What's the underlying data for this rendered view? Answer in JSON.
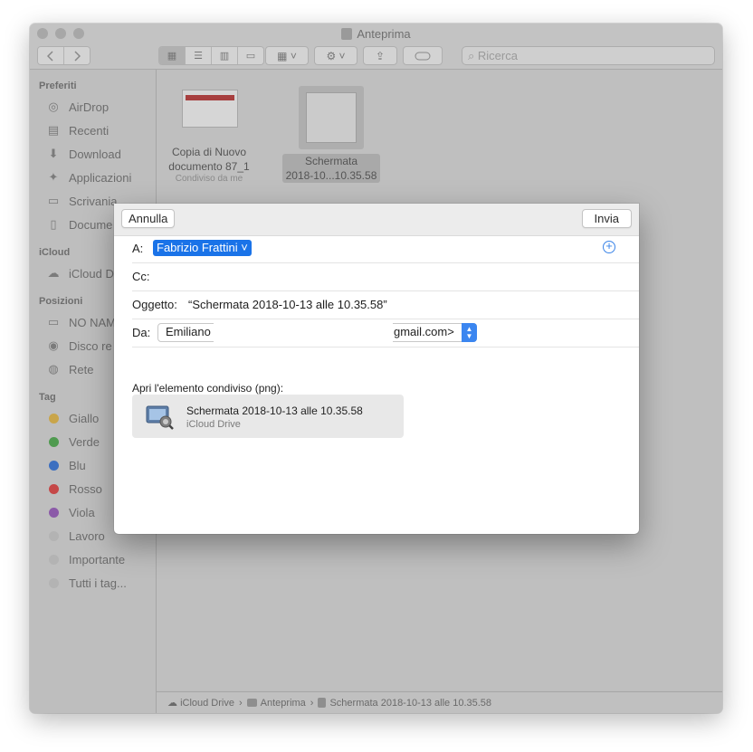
{
  "window": {
    "title": "Anteprima"
  },
  "toolbar": {
    "search_placeholder": "Ricerca"
  },
  "sidebar": {
    "sections": {
      "favorites": "Preferiti",
      "icloud": "iCloud",
      "locations": "Posizioni",
      "tags": "Tag"
    },
    "favorites": [
      {
        "label": "AirDrop",
        "icon": "airdrop-icon"
      },
      {
        "label": "Recenti",
        "icon": "recents-icon"
      },
      {
        "label": "Download",
        "icon": "download-icon"
      },
      {
        "label": "Applicazioni",
        "icon": "applications-icon"
      },
      {
        "label": "Scrivania",
        "icon": "desktop-icon"
      },
      {
        "label": "Docume",
        "icon": "documents-icon"
      }
    ],
    "icloud_items": [
      {
        "label": "iCloud D",
        "icon": "cloud-icon"
      }
    ],
    "locations": [
      {
        "label": "NO NAM",
        "icon": "drive-icon"
      },
      {
        "label": "Disco re",
        "icon": "disc-icon"
      },
      {
        "label": "Rete",
        "icon": "network-icon"
      }
    ],
    "tags": [
      {
        "label": "Giallo",
        "color": "#c9a54a"
      },
      {
        "label": "Verde",
        "color": "#4f9a4f"
      },
      {
        "label": "Blu",
        "color": "#3c6fc0"
      },
      {
        "label": "Rosso",
        "color": "#c54848"
      },
      {
        "label": "Viola",
        "color": "#8b5aa8"
      },
      {
        "label": "Lavoro",
        "color": "#b3b3b3"
      },
      {
        "label": "Importante",
        "color": "#b3b3b3"
      },
      {
        "label": "Tutti i tag...",
        "color": "#b3b3b3"
      }
    ]
  },
  "files": [
    {
      "name_line1": "Copia di Nuovo",
      "name_line2": "documento 87_1",
      "subtitle": "Condiviso da me"
    },
    {
      "name_line1": "Schermata",
      "name_line2": "2018-10...10.35.58"
    }
  ],
  "pathbar": {
    "items": [
      "iCloud Drive",
      "Anteprima",
      "Schermata 2018-10-13 alle 10.35.58"
    ],
    "separator": "›"
  },
  "sheet": {
    "cancel_label": "Annulla",
    "send_label": "Invia",
    "to_label": "A:",
    "to_recipient": "Fabrizio Frattini ˅",
    "cc_label": "Cc:",
    "subject_label": "Oggetto:",
    "subject_value": "“Schermata 2018-10-13 alle 10.35.58”",
    "from_label": "Da:",
    "from_value_start": "Emiliano",
    "from_value_end": "gmail.com>",
    "attachment_caption": "Apri l'elemento condiviso (png):",
    "attachment_title": "Schermata 2018-10-13 alle 10.35.58",
    "attachment_location": "iCloud Drive"
  }
}
